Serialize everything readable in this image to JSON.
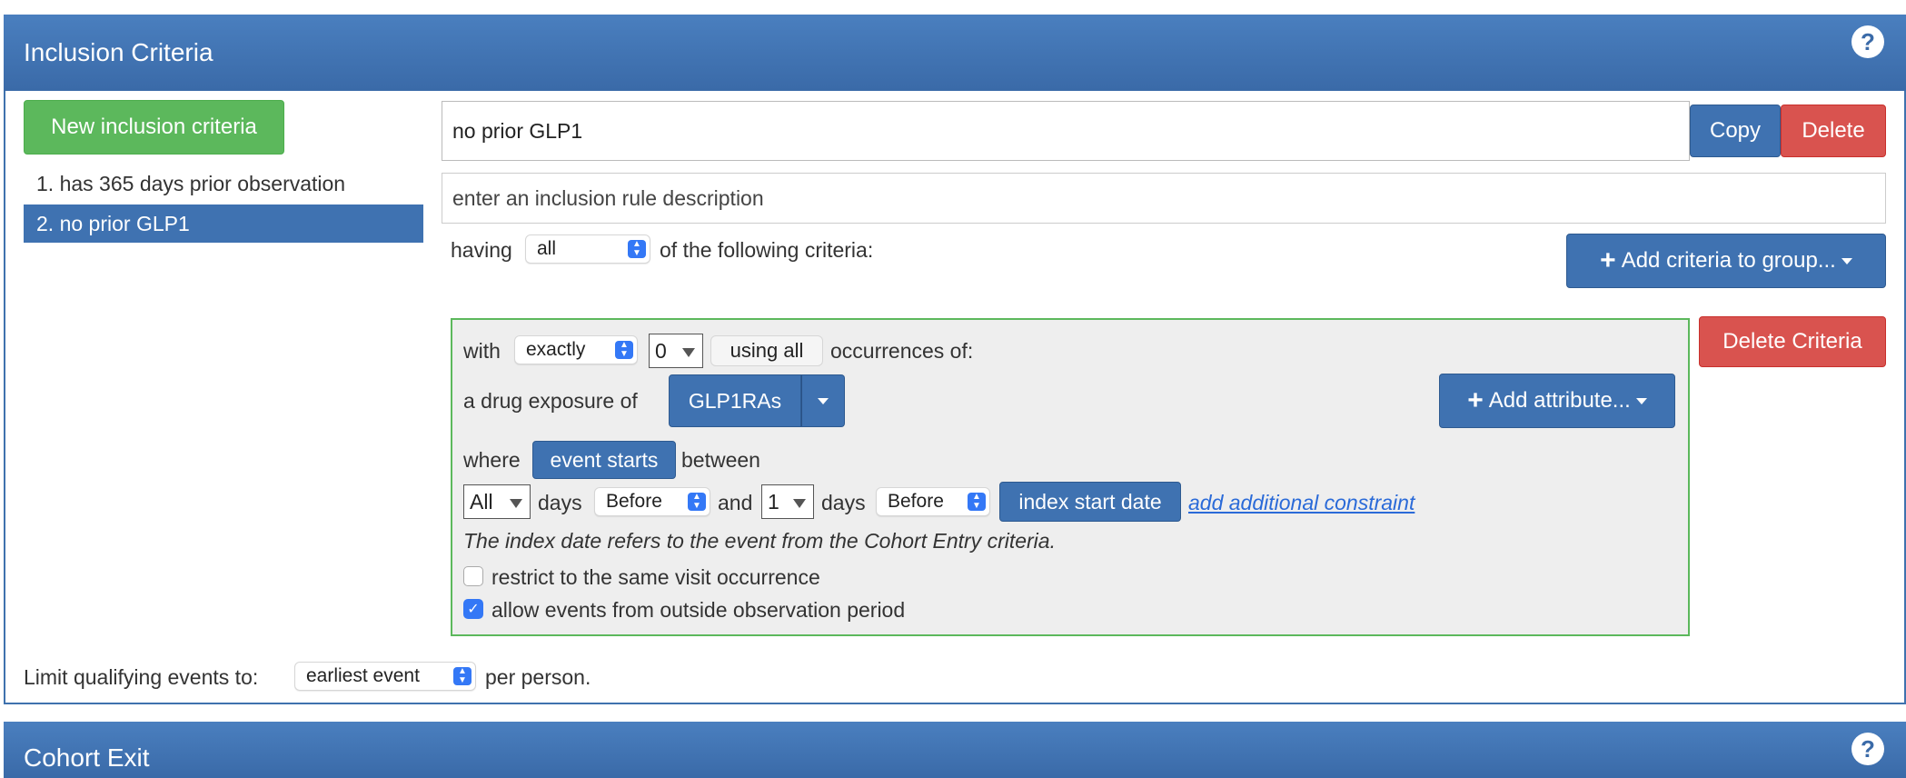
{
  "inclusion_panel": {
    "title": "Inclusion Criteria",
    "new_button": "New inclusion criteria",
    "rules": [
      {
        "num": "1.",
        "label": "has 365 days prior observation"
      },
      {
        "num": "2.",
        "label": "no prior GLP1"
      }
    ],
    "rule_name_value": "no prior GLP1",
    "copy_label": "Copy",
    "delete_label": "Delete",
    "description_placeholder": "enter an inclusion rule description",
    "having_label": "having",
    "having_select": "all",
    "following_label": "of the following criteria:",
    "add_criteria_label": "Add criteria to group...",
    "limit_label": "Limit qualifying events to:",
    "limit_select": "earliest event",
    "per_person_label": "per person."
  },
  "criteria": {
    "with_label": "with",
    "exactly_select": "exactly",
    "count_value": "0",
    "using_all_label": "using all",
    "occurrences_label": "occurrences of:",
    "drug_exposure_label": "a drug exposure of",
    "concept_set": "GLP1RAs",
    "add_attribute_label": "Add attribute...",
    "delete_criteria_label": "Delete Criteria",
    "where_label": "where",
    "event_starts_label": "event starts",
    "between_label": "between",
    "from_days_value": "All",
    "days_label_1": "days",
    "before_select_1": "Before",
    "and_label": "and",
    "to_days_value": "1",
    "days_label_2": "days",
    "before_select_2": "Before",
    "index_start_label": "index start date",
    "add_constraint_link": "add additional constraint",
    "index_note": "The index date refers to the event from the Cohort Entry criteria.",
    "restrict_visit_label": "restrict to the same visit occurrence",
    "restrict_visit_checked": false,
    "allow_outside_label": "allow events from outside observation period",
    "allow_outside_checked": true
  },
  "cohort_exit_panel": {
    "title": "Cohort Exit"
  },
  "icons": {
    "help": "?",
    "check": "✓",
    "plus": "+"
  },
  "colors": {
    "header_blue": "#3f72b1",
    "green": "#5cb85c",
    "red": "#d9534f",
    "link_blue": "#2a6ad8"
  }
}
